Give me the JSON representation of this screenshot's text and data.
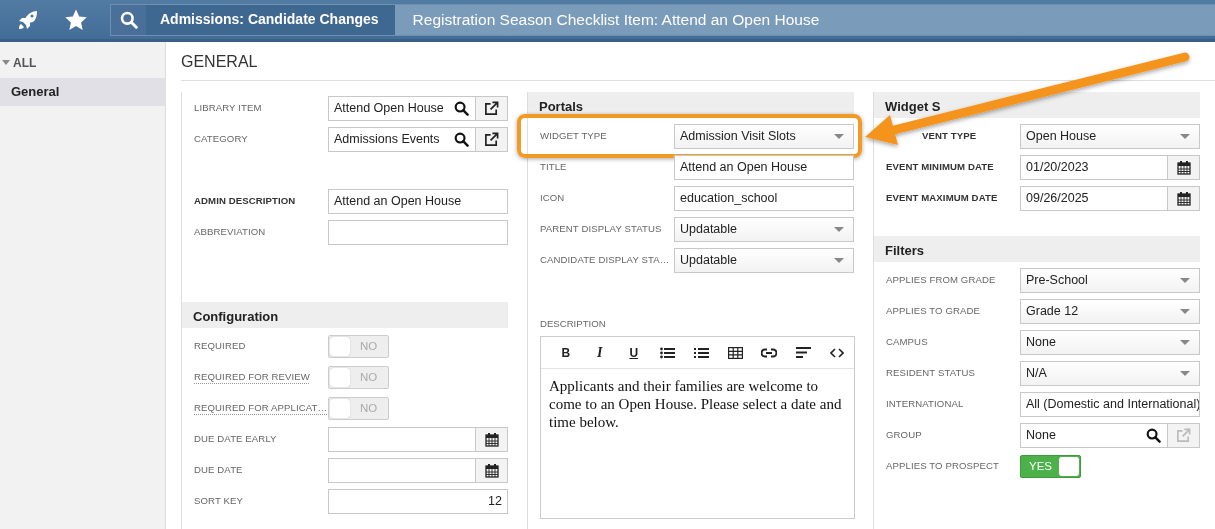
{
  "topbar": {
    "breadcrumbs": [
      {
        "label": "Admissions: Candidate Changes",
        "current": false
      },
      {
        "label": "Registration Season Checklist Item: Attend an Open House",
        "current": true
      }
    ]
  },
  "sidebar": {
    "tree": [
      {
        "label": "ALL",
        "expanded": true,
        "children": [
          {
            "label": "General",
            "selected": true
          }
        ]
      }
    ]
  },
  "page_title": "GENERAL",
  "annotation_arrow": true,
  "columns": [
    {
      "sections": [
        {
          "fields": [
            {
              "label": "LIBRARY ITEM",
              "kind": "lookup",
              "value": "Attend Open House",
              "link_disabled": false
            },
            {
              "label": "CATEGORY",
              "kind": "lookup",
              "value": "Admissions Events",
              "link_disabled": false
            },
            {
              "label": "ADMIN DESCRIPTION",
              "kind": "text",
              "value": "Attend an Open House",
              "bold": true
            },
            {
              "label": "ABBREVIATION",
              "kind": "text"
            }
          ]
        },
        {
          "title": "Configuration",
          "fields": [
            {
              "label": "REQUIRED",
              "kind": "toggle",
              "on": false,
              "text": "NO"
            },
            {
              "label": "REQUIRED FOR REVIEW",
              "kind": "toggle",
              "on": false,
              "text": "NO",
              "help": true
            },
            {
              "label": "REQUIRED FOR APPLICAT…",
              "kind": "toggle",
              "on": false,
              "text": "NO",
              "help": true
            },
            {
              "label": "DUE DATE EARLY",
              "kind": "date"
            },
            {
              "label": "DUE DATE",
              "kind": "date"
            },
            {
              "label": "SORT KEY",
              "kind": "number",
              "value": "12"
            }
          ]
        }
      ]
    },
    {
      "sections": [
        {
          "title": "Portals",
          "fields": [
            {
              "label": "WIDGET TYPE",
              "kind": "select",
              "value": "Admission Visit Slots",
              "highlighted": true
            },
            {
              "label": "TITLE",
              "kind": "text",
              "value": "Attend an Open House"
            },
            {
              "label": "ICON",
              "kind": "text",
              "value": "education_school"
            },
            {
              "label": "PARENT DISPLAY STATUS",
              "kind": "select",
              "value": "Updatable"
            },
            {
              "label": "CANDIDATE DISPLAY STA…",
              "kind": "select",
              "value": "Updatable"
            },
            {
              "label": "DESCRIPTION",
              "kind": "editor",
              "text": "Applicants and their families are welcome to come to an Open House. Please select a date and time below.",
              "toolbar": [
                {
                  "kind": "bold",
                  "text": "B"
                },
                {
                  "kind": "italic",
                  "text": "I"
                },
                {
                  "kind": "underline",
                  "text": "U"
                },
                {
                  "kind": "bullets"
                },
                {
                  "kind": "numbers"
                },
                {
                  "kind": "table"
                },
                {
                  "kind": "link"
                },
                {
                  "kind": "align"
                },
                {
                  "kind": "code"
                }
              ]
            }
          ]
        }
      ]
    },
    {
      "sections": [
        {
          "title": "Widget S",
          "fields": [
            {
              "label": "VENT TYPE",
              "kind": "select",
              "value": "Open House",
              "bold": true
            },
            {
              "label": "EVENT MINIMUM DATE",
              "kind": "date",
              "value": "01/20/2023",
              "bold": true
            },
            {
              "label": "EVENT MAXIMUM DATE",
              "kind": "date",
              "value": "09/26/2025",
              "bold": true
            }
          ]
        },
        {
          "title": "Filters",
          "fields": [
            {
              "label": "APPLIES FROM GRADE",
              "kind": "select",
              "value": "Pre-School"
            },
            {
              "label": "APPLIES TO GRADE",
              "kind": "select",
              "value": "Grade 12"
            },
            {
              "label": "CAMPUS",
              "kind": "select",
              "value": "None"
            },
            {
              "label": "RESIDENT STATUS",
              "kind": "select",
              "value": "N/A"
            },
            {
              "label": "INTERNATIONAL",
              "kind": "text",
              "value": "All (Domestic and International)"
            },
            {
              "label": "GROUP",
              "kind": "lookup",
              "value": "None",
              "link_disabled": true
            },
            {
              "label": "APPLIES TO PROSPECT",
              "kind": "toggle",
              "on": true,
              "text": "YES"
            }
          ]
        }
      ]
    }
  ]
}
